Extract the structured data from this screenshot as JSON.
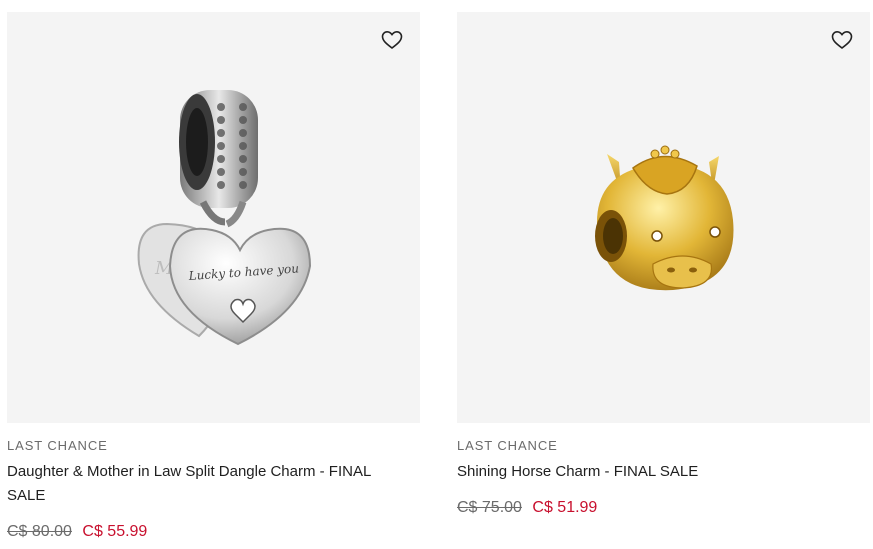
{
  "products": [
    {
      "badge": "LAST CHANCE",
      "name": "Daughter & Mother in Law Split Dangle Charm - FINAL SALE",
      "original_price": "C$ 80.00",
      "sale_price": "C$ 55.99",
      "engraving": "Lucky to have you",
      "engraving_back": "M",
      "wishlist_icon": "heart-outline-icon"
    },
    {
      "badge": "LAST CHANCE",
      "name": "Shining Horse Charm - FINAL SALE",
      "original_price": "C$ 75.00",
      "sale_price": "C$ 51.99",
      "wishlist_icon": "heart-outline-icon"
    }
  ],
  "colors": {
    "image_bg": "#f4f4f4",
    "sale_price": "#c8102e",
    "muted_text": "#6b6b6b"
  }
}
